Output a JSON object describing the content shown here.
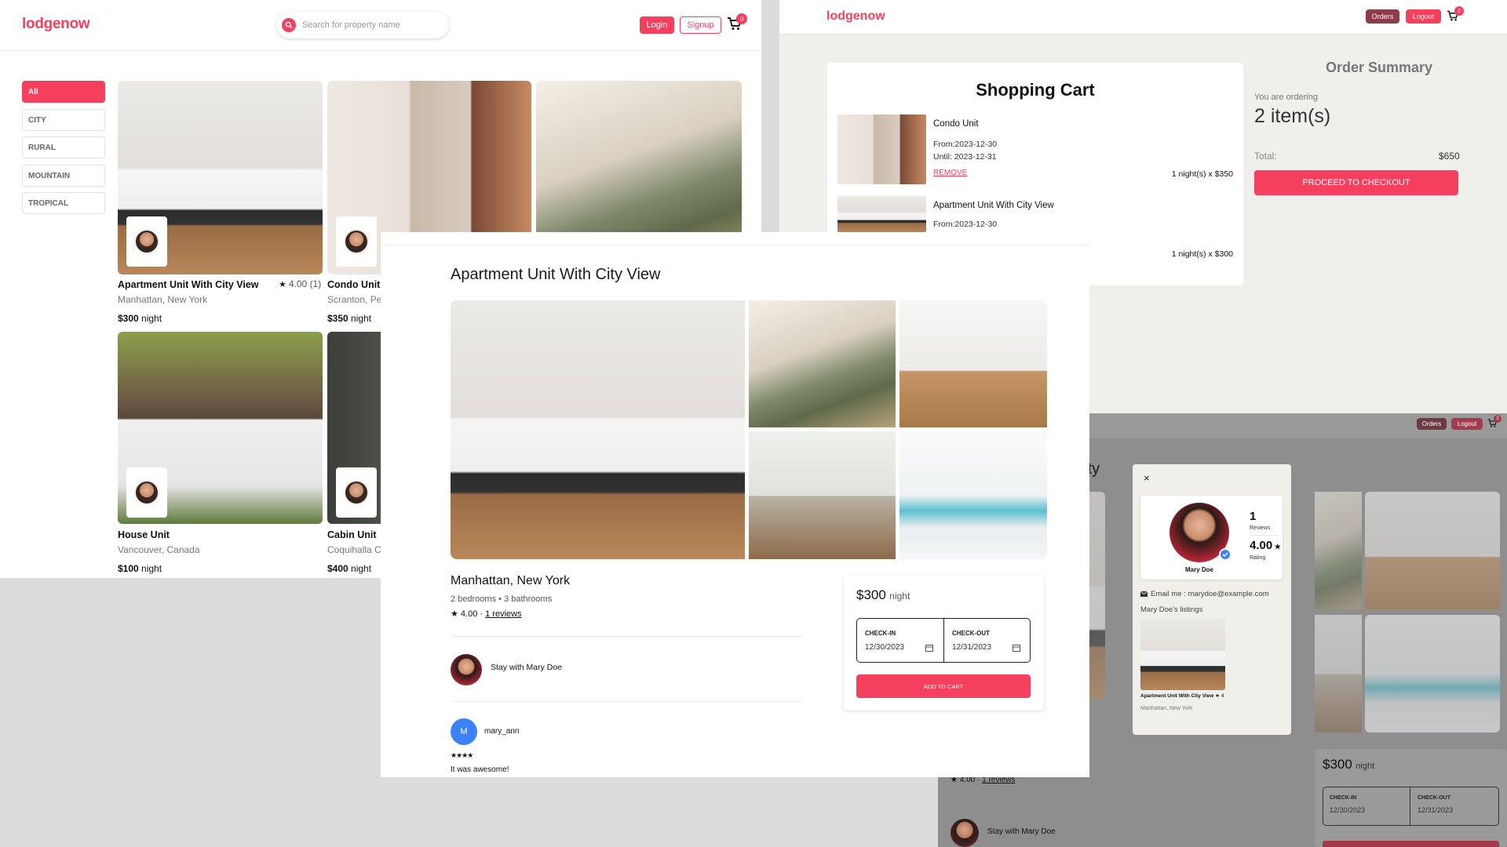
{
  "brand": "lodgenow",
  "listing_page": {
    "search_placeholder": "Search for property name",
    "login_label": "Login",
    "signup_label": "Signup",
    "cart_count": "0",
    "categories": [
      "All",
      "CITY",
      "RURAL",
      "MOUNTAIN",
      "TROPICAL"
    ],
    "cards": [
      {
        "title": "Apartment Unit With City View",
        "location": "Manhattan, New York",
        "price": "$300",
        "unit": " night",
        "rating": "4.00 (1)"
      },
      {
        "title": "Condo Unit",
        "location": "Scranton, Pe",
        "price": "$350",
        "unit": " night"
      },
      {
        "title": "House Unit",
        "location": "Vancouver, Canada",
        "price": "$100",
        "unit": " night"
      },
      {
        "title": "Cabin Unit",
        "location": "Coquihalla C",
        "price": "$400",
        "unit": " night"
      }
    ]
  },
  "cart_page": {
    "orders_label": "Orders",
    "logout_label": "Logout",
    "cart_count": "2",
    "title": "Shopping Cart",
    "items": [
      {
        "name": "Condo Unit",
        "from": "From:2023-12-30",
        "until": "Until: 2023-12-31",
        "remove": "REMOVE",
        "qty": "1 night(s) x $350"
      },
      {
        "name": "Apartment Unit With City View",
        "from": "From:2023-12-30",
        "qty": "1 night(s) x $300"
      }
    ],
    "summary": {
      "title": "Order Summary",
      "ordering_label": "You are ordering",
      "item_count": "2 item(s)",
      "total_label": "Total:",
      "total_value": "$650",
      "checkout_label": "PROCEED TO CHECKOUT"
    }
  },
  "detail_page": {
    "title": "Apartment Unit With City View",
    "location": "Manhattan, New York",
    "rooms": "2 bedrooms",
    "baths": "3 bathrooms",
    "rating": "4.00 · ",
    "reviews_link": "1 reviews",
    "host_line": "Stay with Mary Doe",
    "reviewer_initial": "M",
    "reviewer_name": "mary_ann",
    "review_stars": "★★★★",
    "review_text": "It was awesome!",
    "price": "$300",
    "unit": "night",
    "checkin_label": "CHECK-IN",
    "checkin_value": "12/30/2023",
    "checkout_label": "CHECK-OUT",
    "checkout_value": "12/31/2023",
    "add_to_cart": "ADD TO CART"
  },
  "host_modal_page": {
    "orders_label": "Orders",
    "logout_label": "Logout",
    "cart_count": "2",
    "title_partial": "h City",
    "close": "×",
    "reviews_count": "1",
    "reviews_label": "Reviews",
    "rating": "4.00",
    "rating_label": "Rating",
    "host_name": "Mary Doe",
    "email": "Email me : marydoe@example.com",
    "listings_heading": "Mary Doe's listings",
    "listing_title": "Apartment Unit With City View",
    "listing_rating": "4",
    "listing_location": "Manhattan, New York",
    "bg_rating": "4.00 · ",
    "bg_reviews": "1 reviews",
    "bg_host": "Stay with Mary Doe",
    "bg_price": "$300",
    "bg_unit": "night",
    "bg_checkin_label": "CHECK-IN",
    "bg_checkin": "12/30/2023",
    "bg_checkout_label": "CHECK-OUT",
    "bg_checkout": "12/31/2023"
  }
}
